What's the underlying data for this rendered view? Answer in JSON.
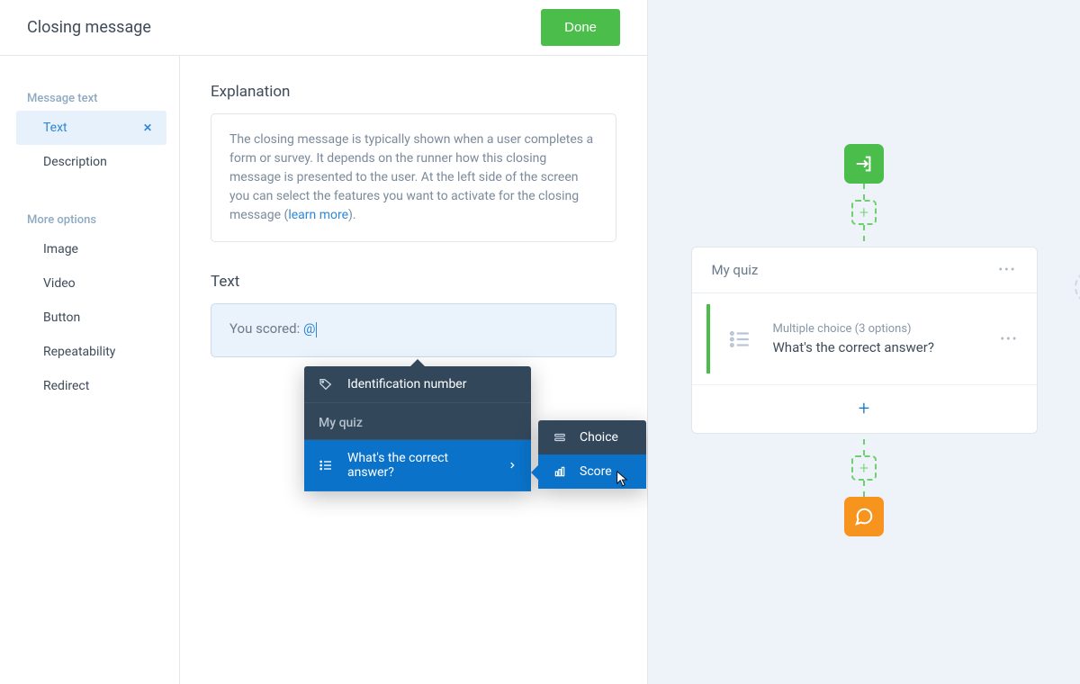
{
  "header": {
    "title": "Closing message",
    "done_label": "Done"
  },
  "sidebar": {
    "section1_title": "Message text",
    "section2_title": "More options",
    "items1": [
      {
        "label": "Text",
        "active": true
      },
      {
        "label": "Description"
      }
    ],
    "items2": [
      {
        "label": "Image"
      },
      {
        "label": "Video"
      },
      {
        "label": "Button"
      },
      {
        "label": "Repeatability"
      },
      {
        "label": "Redirect"
      }
    ]
  },
  "content": {
    "explanation_heading": "Explanation",
    "explanation_text": "The closing message is typically shown when a user completes a form or survey. It depends on the runner how this closing message is presented to the user. At the left side of the screen you can select the features you want to activate for the closing message (",
    "learn_more": "learn more",
    "text_heading": "Text",
    "text_value_prefix": "You scored: ",
    "text_value_mention": "@"
  },
  "mention_menu": {
    "global_item": "Identification number",
    "group_title": "My quiz",
    "question_item": "What's the correct answer?",
    "sub_items": [
      {
        "label": "Choice"
      },
      {
        "label": "Score"
      }
    ]
  },
  "preview": {
    "card_title": "My quiz",
    "question_meta": "Multiple choice (3 options)",
    "question_text": "What's the correct answer?"
  },
  "colors": {
    "accent_blue": "#0a72c8",
    "green": "#4bbd4b",
    "orange": "#f7941d"
  }
}
